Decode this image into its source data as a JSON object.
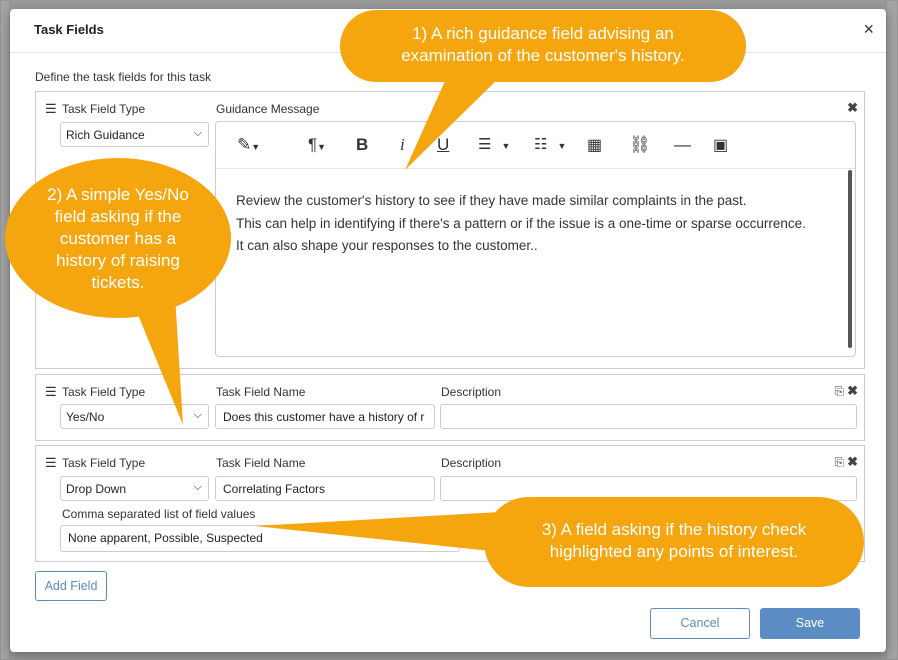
{
  "modal": {
    "title": "Task Fields",
    "close_icon": "×",
    "define_label": "Define the task fields for this task"
  },
  "card1": {
    "type_label": "Task Field Type",
    "type_value": "Rich Guidance",
    "message_label": "Guidance Message",
    "editor_lines": [
      "Review the customer's history to see if they have made similar complaints in the past.",
      "This can help in identifying if there's a pattern or if the issue is a one-time or sparse occurrence.",
      "It can also shape your responses to the customer.."
    ]
  },
  "card2": {
    "type_label": "Task Field Type",
    "type_value": "Yes/No",
    "name_label": "Task Field Name",
    "name_value": "Does this customer have a history of r",
    "desc_label": "Description",
    "desc_value": ""
  },
  "card3": {
    "type_label": "Task Field Type",
    "type_value": "Drop Down",
    "name_label": "Task Field Name",
    "name_value": "Correlating Factors",
    "desc_label": "Description",
    "desc_value": "",
    "values_label": "Comma separated list of field values",
    "values_value": "None apparent, Possible, Suspected"
  },
  "buttons": {
    "add_field": "Add Field",
    "cancel": "Cancel",
    "save": "Save"
  },
  "callouts": {
    "one": [
      "1) A rich guidance field advising an",
      "examination of the customer's history."
    ],
    "two": [
      "2) A simple Yes/No",
      "field asking if the",
      "customer has a",
      "history of raising",
      "tickets."
    ],
    "three": [
      "3) A field asking if the history check",
      "highlighted any points of interest."
    ]
  },
  "colors": {
    "callout": "#f5a60e",
    "primary": "#5b8dc4"
  }
}
